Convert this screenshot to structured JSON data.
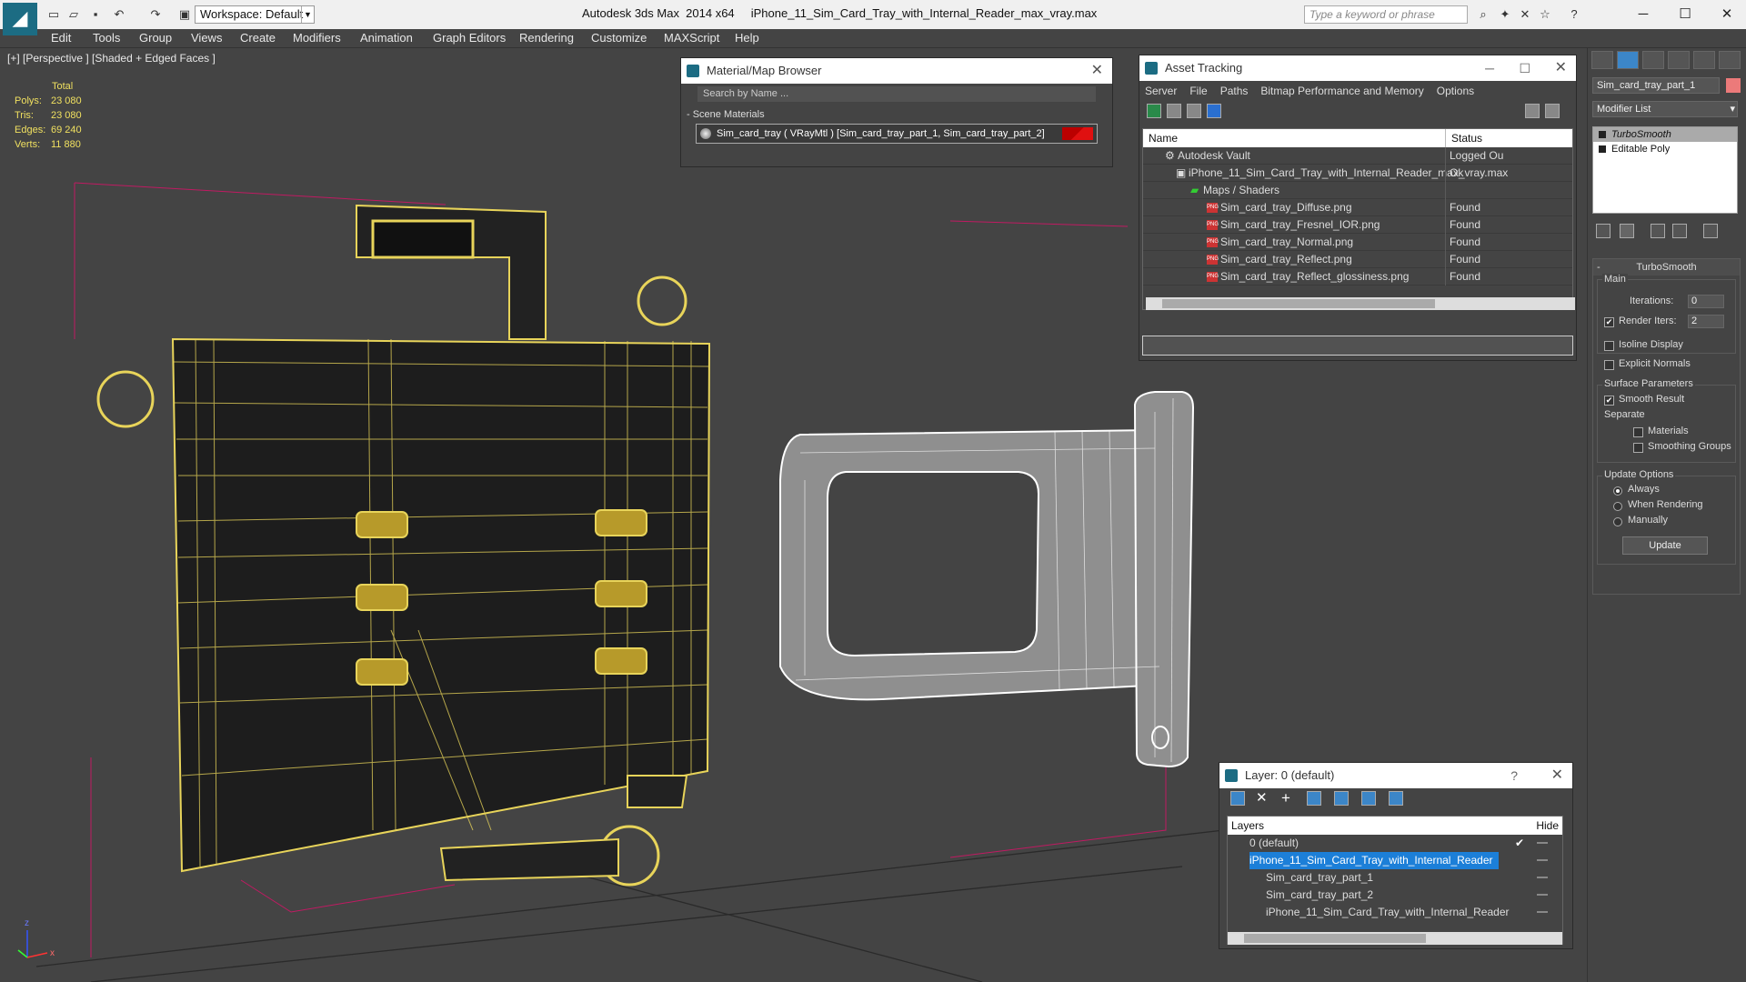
{
  "app": {
    "title": "Autodesk 3ds Max  2014 x64",
    "file": "iPhone_11_Sim_Card_Tray_with_Internal_Reader_max_vray.max",
    "workspace": "Workspace: Default",
    "search_placeholder": "Type a keyword or phrase"
  },
  "menu": [
    "Edit",
    "Tools",
    "Group",
    "Views",
    "Create",
    "Modifiers",
    "Animation",
    "Graph Editors",
    "Rendering",
    "Customize",
    "MAXScript",
    "Help"
  ],
  "viewport": {
    "label": "[+] [Perspective ] [Shaded + Edged Faces ]",
    "stats_header": "Total",
    "stats": [
      {
        "k": "Polys:",
        "v": "23 080"
      },
      {
        "k": "Tris:",
        "v": "23 080"
      },
      {
        "k": "Edges:",
        "v": "69 240"
      },
      {
        "k": "Verts:",
        "v": "11 880"
      }
    ],
    "axis_labels": {
      "z": "z",
      "x": "x"
    }
  },
  "material_browser": {
    "title": "Material/Map Browser",
    "search": "Search by Name ...",
    "section": "- Scene Materials",
    "item": "Sim_card_tray  ( VRayMtl ) [Sim_card_tray_part_1, Sim_card_tray_part_2]"
  },
  "asset_tracking": {
    "title": "Asset Tracking",
    "menu": [
      "Server",
      "File",
      "Paths",
      "Bitmap Performance and Memory",
      "Options"
    ],
    "col_name": "Name",
    "col_status": "Status",
    "rows": [
      {
        "name": "Autodesk Vault",
        "status": "Logged Ou"
      },
      {
        "name": "iPhone_11_Sim_Card_Tray_with_Internal_Reader_max_vray.max",
        "status": "Ok"
      },
      {
        "name": "Maps / Shaders",
        "status": ""
      },
      {
        "name": "Sim_card_tray_Diffuse.png",
        "status": "Found"
      },
      {
        "name": "Sim_card_tray_Fresnel_IOR.png",
        "status": "Found"
      },
      {
        "name": "Sim_card_tray_Normal.png",
        "status": "Found"
      },
      {
        "name": "Sim_card_tray_Reflect.png",
        "status": "Found"
      },
      {
        "name": "Sim_card_tray_Reflect_glossiness.png",
        "status": "Found"
      }
    ]
  },
  "layer_dialog": {
    "title": "Layer: 0 (default)",
    "help": "?",
    "col_layers": "Layers",
    "col_hide": "Hide",
    "rows": [
      {
        "name": "0 (default)"
      },
      {
        "name": "iPhone_11_Sim_Card_Tray_with_Internal_Reader"
      },
      {
        "name": "Sim_card_tray_part_1"
      },
      {
        "name": "Sim_card_tray_part_2"
      },
      {
        "name": "iPhone_11_Sim_Card_Tray_with_Internal_Reader"
      }
    ]
  },
  "command_panel": {
    "object_name": "Sim_card_tray_part_1",
    "object_color": "#ec7a7a",
    "modifier_list": "Modifier List",
    "stack": [
      "TurboSmooth",
      "Editable Poly"
    ],
    "turbosmooth": {
      "title": "TurboSmooth",
      "main": "Main",
      "iterations_label": "Iterations:",
      "iterations": "0",
      "render_iters_label": "Render Iters:",
      "render_iters": "2",
      "isoline": "Isoline Display",
      "explicit": "Explicit Normals",
      "surface": "Surface Parameters",
      "smooth_result": "Smooth Result",
      "separate": "Separate",
      "materials": "Materials",
      "smoothing_groups": "Smoothing Groups",
      "update_options": "Update Options",
      "always": "Always",
      "when_rendering": "When Rendering",
      "manually": "Manually",
      "update": "Update"
    }
  },
  "colors": {
    "wire_yellow": "#e8d45a",
    "wire_white": "#ffffff",
    "accent": "#1c7fd8",
    "selection_red": "#e0106a"
  }
}
